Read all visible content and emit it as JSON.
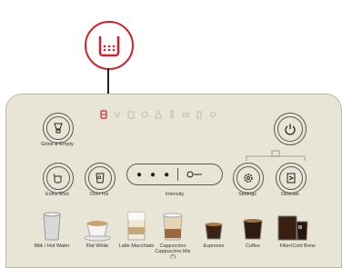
{
  "highlight": {
    "color": "#d21f2b",
    "icon": "water-tank-icon"
  },
  "status_icons": [
    "water-tank-icon",
    "descale-icon",
    "cup-icon",
    "grounds-container-icon",
    "warning-icon",
    "filter-icon",
    "drip-tray-icon",
    "milk-carafe-icon",
    "settings-icon"
  ],
  "buttons": {
    "grind_empty": "Grind & Empty",
    "extra_shot": "Extra Shot",
    "over_ice": "Over Ice",
    "intensity": "Intensity",
    "settings": "Settings",
    "descale": "Descale"
  },
  "beverages": [
    {
      "label": "Milk / Hot Water"
    },
    {
      "label": "Flat White"
    },
    {
      "label": "Latte Macchiato"
    },
    {
      "label": "Cappuccino"
    },
    {
      "label": "Espresso"
    },
    {
      "label": "Coffee"
    },
    {
      "label": "Filter/Cold Brew"
    }
  ],
  "cappuccino_sub": "Cappuccino Mix",
  "cappuccino_note": "(*)"
}
